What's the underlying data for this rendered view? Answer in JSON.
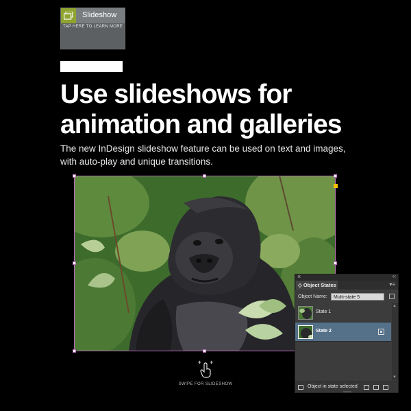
{
  "badge": {
    "title": "Slideshow",
    "subtitle": "TAP HERE TO LEARN MORE",
    "icon": "slideshow-icon",
    "accent": "#8fa42f"
  },
  "headline": {
    "line1": "Use slideshows for",
    "line2": "animation and galleries"
  },
  "lede": "The new InDesign slideshow feature can be used on text and images, with auto-play and unique transitions.",
  "swipe": {
    "icon": "hand-swipe-icon",
    "label": "SWIPE FOR SLIDESHOW"
  },
  "panel": {
    "close_glyph": "×",
    "collapse_glyph": "‹‹",
    "tab_label": "◇ Object States",
    "menu_glyph": "▾≡",
    "object_name_label": "Object Name:",
    "object_name_value": "Multi-state 5",
    "states": [
      {
        "label": "State 1",
        "selected": false
      },
      {
        "label": "State 2",
        "selected": true
      }
    ],
    "status": "Object in state selected",
    "selection_color": "#557089"
  },
  "frame": {
    "selection_color": "#b86fb8",
    "anchor_color": "#f2c200"
  }
}
